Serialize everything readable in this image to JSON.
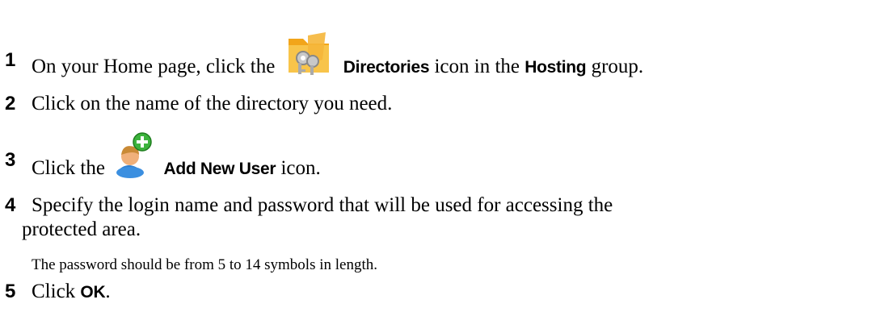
{
  "steps": [
    {
      "number": "1",
      "before": "On your Home page, click the",
      "ui1": "Directories",
      "middle": "icon in the",
      "ui2": "Hosting",
      "after": "group.",
      "icon": "directories-folder-key-icon"
    },
    {
      "number": "2",
      "text": "Click on the name of the directory you need."
    },
    {
      "number": "3",
      "before": "Click the",
      "ui1": "Add New User",
      "after": "icon.",
      "icon": "add-new-user-icon"
    },
    {
      "number": "4",
      "line1": "Specify the login name and password that will be used for accessing the",
      "line2": "protected area.",
      "note": "The password should be from 5 to 14 symbols in length."
    },
    {
      "number": "5",
      "before": "Click",
      "ui1": "OK",
      "after": "."
    }
  ]
}
